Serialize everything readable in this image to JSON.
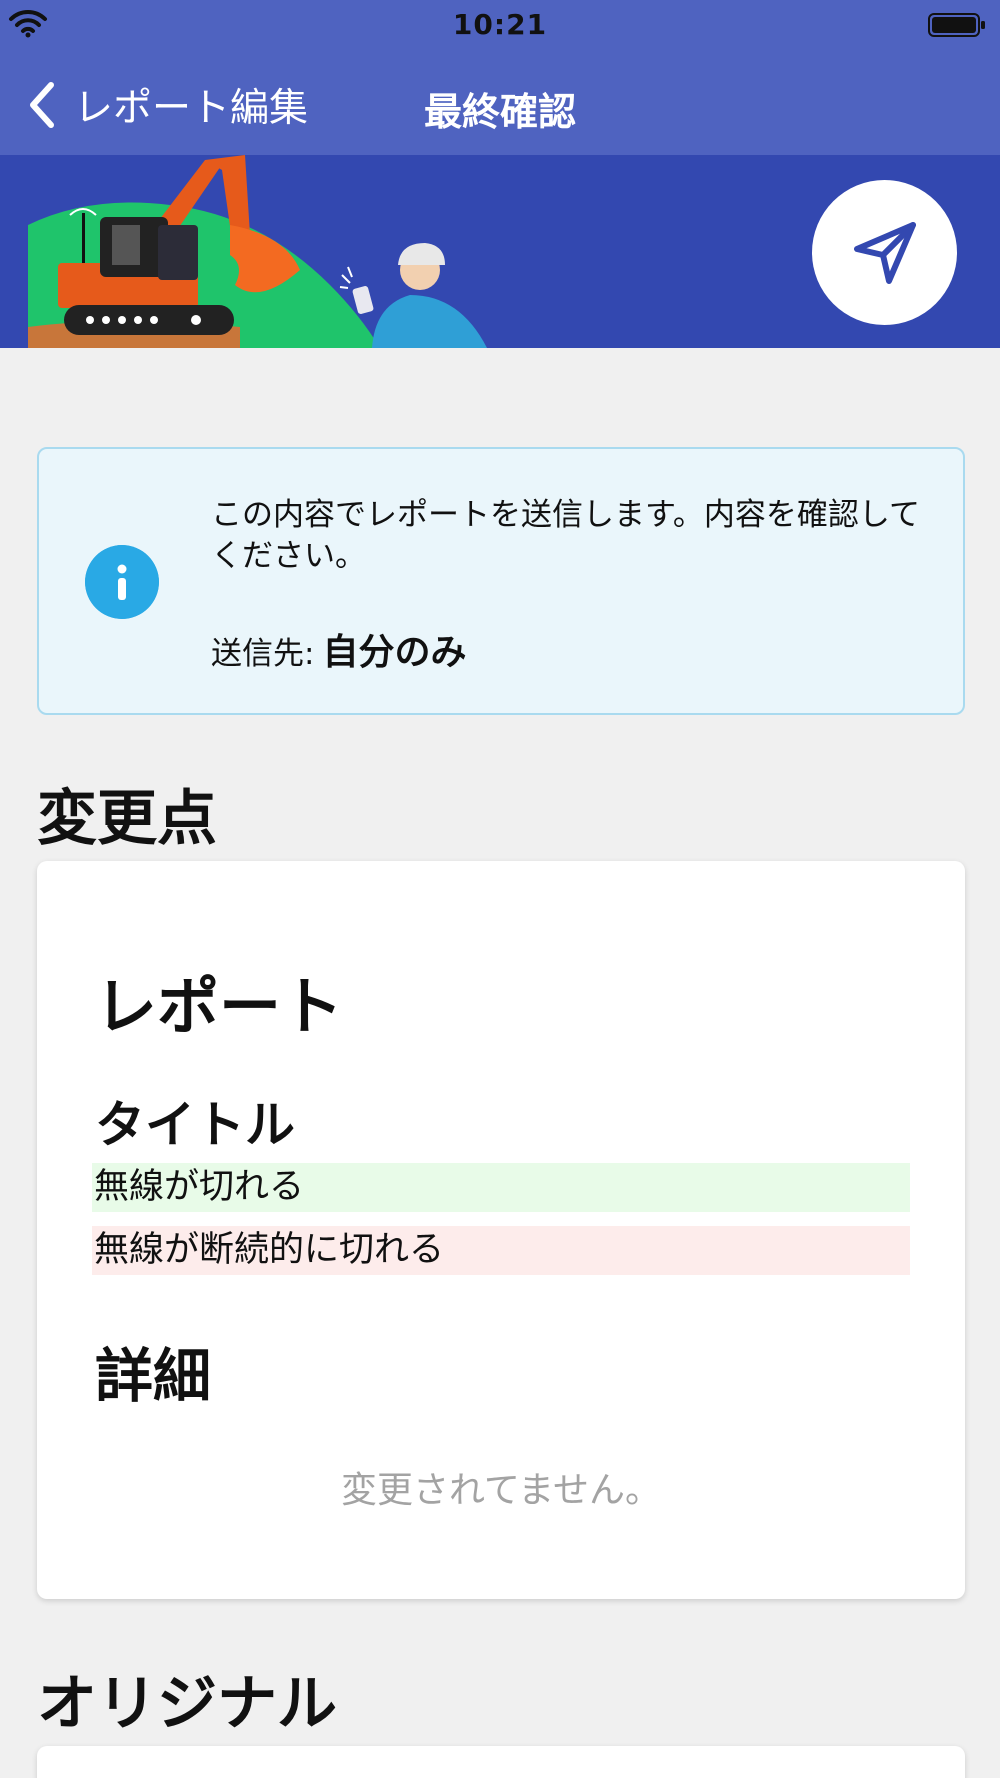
{
  "status_bar": {
    "time": "10:21"
  },
  "nav": {
    "back_label": "レポート編集",
    "title": "最終確認"
  },
  "colors": {
    "nav_bg": "#4f63c0",
    "banner_bg": "#3348b0",
    "info_icon": "#29a9e5",
    "info_bg": "#eaf6fb",
    "added_bg": "#e8fbe8",
    "removed_bg": "#fdeceb"
  },
  "info": {
    "message": "この内容でレポートを送信します。内容を確認してください。",
    "destination_label": "送信先:",
    "destination_value": "自分のみ"
  },
  "changes": {
    "heading": "変更点",
    "card_title": "レポート",
    "title_field_label": "タイトル",
    "title_added": "無線が切れる",
    "title_removed": "無線が断続的に切れる",
    "detail_field_label": "詳細",
    "detail_unchanged": "変更されてません。"
  },
  "original": {
    "heading": "オリジナル"
  },
  "icons": [
    "wifi-icon",
    "battery-icon",
    "back-chevron-icon",
    "send-icon",
    "info-icon"
  ]
}
